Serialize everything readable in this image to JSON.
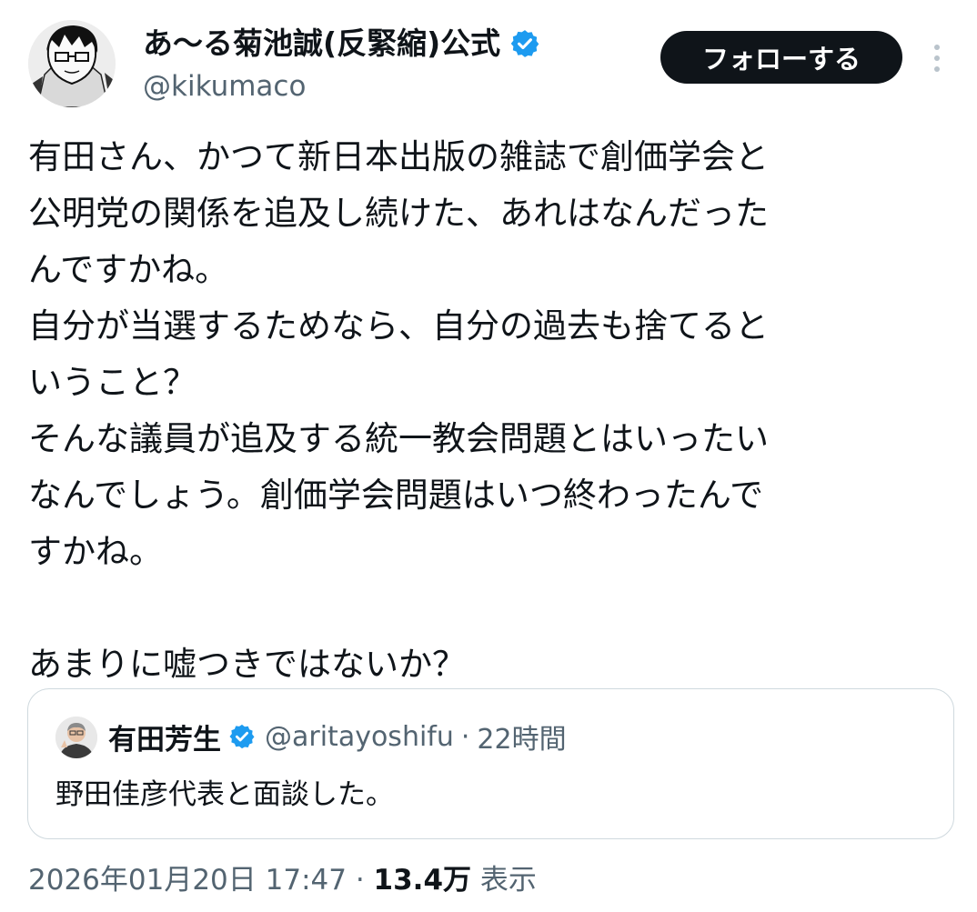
{
  "author": {
    "display_name": "あ〜る菊池誠(反緊縮)公式",
    "handle": "@kikumaco",
    "avatar_icon": "manga-portrait-avatar",
    "verified_icon": "verified-badge-icon"
  },
  "follow_button": {
    "label": "フォローする"
  },
  "more_icon": "more-vertical-icon",
  "tweet": {
    "text": "有田さん、かつて新日本出版の雑誌で創価学会と\n公明党の関係を追及し続けた、あれはなんだった\nんですかね。\n自分が当選するためなら、自分の過去も捨てると\nいうこと？\nそんな議員が追及する統一教会問題とはいったい\nなんでしょう。創価学会問題はいつ終わったんで\nすかね。\n\nあまりに嘘つきではないか？"
  },
  "quote": {
    "display_name": "有田芳生",
    "handle": "@aritayoshifu",
    "separator": "·",
    "time": "22時間",
    "text": "野田佳彦代表と面談した。"
  },
  "meta": {
    "timestamp": "2026年01月20日 17:47",
    "separator": " · ",
    "views_count": "13.4万",
    "views_label": " 表示"
  },
  "colors": {
    "text": "#0f1419",
    "secondary": "#536471",
    "verified": "#1d9bf0",
    "border": "#cfd9de",
    "button_bg": "#0f1419"
  }
}
